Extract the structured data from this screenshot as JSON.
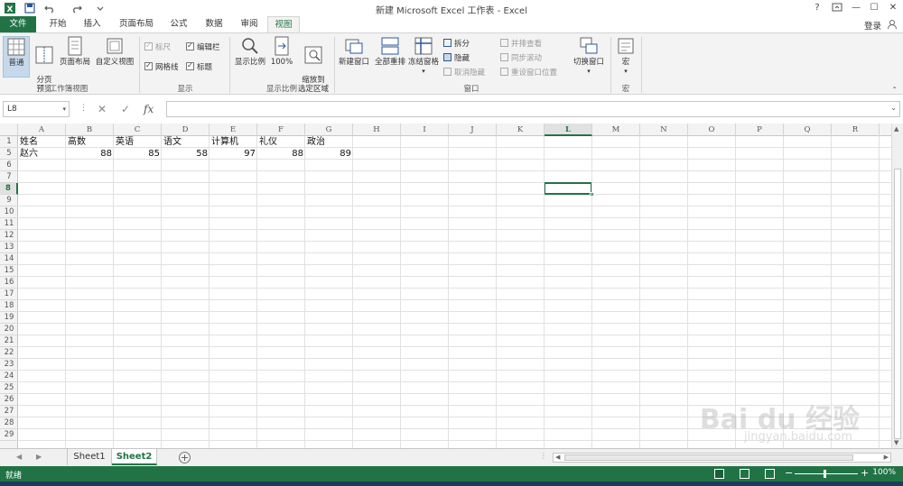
{
  "window": {
    "title": "新建 Microsoft Excel 工作表 - Excel",
    "help": "?",
    "controls": [
      "—",
      "☐",
      "✕"
    ]
  },
  "tabs": [
    {
      "label": "文件",
      "kind": "file"
    },
    {
      "label": "开始"
    },
    {
      "label": "插入"
    },
    {
      "label": "页面布局"
    },
    {
      "label": "公式"
    },
    {
      "label": "数据"
    },
    {
      "label": "审阅"
    },
    {
      "label": "视图",
      "kind": "active"
    }
  ],
  "login": "登录",
  "ribbon": {
    "views": {
      "normal": "普通",
      "page_break": "分页\n预览",
      "page_layout": "页面布局",
      "custom": "自定义视图",
      "group": "工作簿视图"
    },
    "show": {
      "ruler": "标尺",
      "formula_bar": "编辑栏",
      "gridlines": "网格线",
      "headings": "标题",
      "group": "显示"
    },
    "zoom": {
      "zoom": "显示比例",
      "hundred": "100%",
      "to_selection": "缩放到\n选定区域",
      "group": "显示比例"
    },
    "window": {
      "new_window": "新建窗口",
      "arrange_all": "全部重排",
      "freeze": "冻结窗格",
      "split": "拆分",
      "hide": "隐藏",
      "unhide": "取消隐藏",
      "side_by_side": "并排查看",
      "sync_scroll": "同步滚动",
      "reset_pos": "重设窗口位置",
      "switch": "切换窗口",
      "group": "窗口"
    },
    "macros": {
      "macro": "宏",
      "group": "宏"
    }
  },
  "formula_bar": {
    "name_box": "L8",
    "cancel": "✕",
    "enter": "✓",
    "fx": "fx",
    "value": ""
  },
  "columns": [
    "A",
    "B",
    "C",
    "D",
    "E",
    "F",
    "G",
    "H",
    "I",
    "J",
    "K",
    "L",
    "M",
    "N",
    "O",
    "P",
    "Q",
    "R"
  ],
  "selected_column": "L",
  "rows": [
    "1",
    "5",
    "6",
    "7",
    "8",
    "9",
    "10",
    "11",
    "12",
    "13",
    "14",
    "15",
    "16",
    "17",
    "18",
    "19",
    "20",
    "21",
    "22",
    "23",
    "24",
    "25",
    "26",
    "27",
    "28",
    "29"
  ],
  "selected_row": "8",
  "cells": {
    "r1": [
      "姓名",
      "高数",
      "英语",
      "语文",
      "计算机",
      "礼仪",
      "政治"
    ],
    "r5": {
      "name": "赵六",
      "values": [
        "88",
        "85",
        "58",
        "97",
        "88",
        "89"
      ]
    }
  },
  "sheets": [
    {
      "label": "Sheet1"
    },
    {
      "label": "Sheet2",
      "active": true
    }
  ],
  "status": {
    "ready": "就绪",
    "zoom": "100%"
  },
  "watermark": {
    "main": "Bai du 经验",
    "sub": "jingyan.baidu.com"
  }
}
